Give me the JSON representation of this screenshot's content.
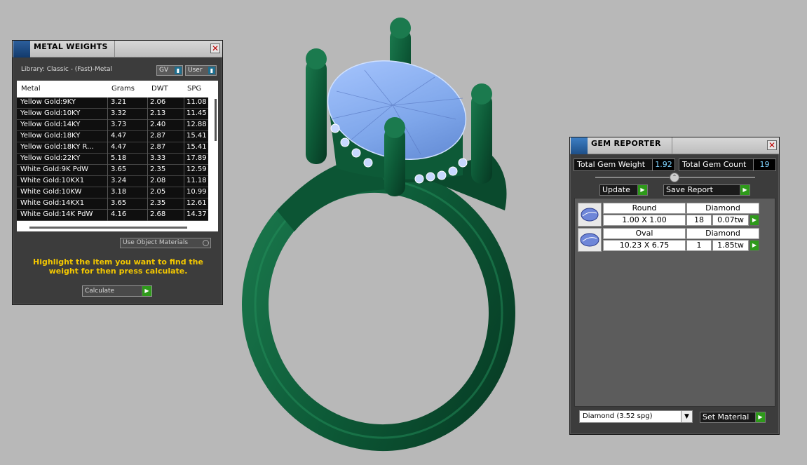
{
  "metal_weights": {
    "title": "METAL WEIGHTS",
    "library": "Library: Classic - (Fast)-Metal",
    "gv_label": "GV",
    "user_label": "User",
    "columns": [
      "Metal",
      "Grams",
      "DWT",
      "SPG"
    ],
    "rows": [
      [
        "Yellow Gold:9KY",
        "3.21",
        "2.06",
        "11.08"
      ],
      [
        "Yellow Gold:10KY",
        "3.32",
        "2.13",
        "11.45"
      ],
      [
        "Yellow Gold:14KY",
        "3.73",
        "2.40",
        "12.88"
      ],
      [
        "Yellow Gold:18KY",
        "4.47",
        "2.87",
        "15.41"
      ],
      [
        "Yellow Gold:18KY R...",
        "4.47",
        "2.87",
        "15.41"
      ],
      [
        "Yellow Gold:22KY",
        "5.18",
        "3.33",
        "17.89"
      ],
      [
        "White Gold:9K PdW",
        "3.65",
        "2.35",
        "12.59"
      ],
      [
        "White Gold:10KX1",
        "3.24",
        "2.08",
        "11.18"
      ],
      [
        "White Gold:10KW",
        "3.18",
        "2.05",
        "10.99"
      ],
      [
        "White Gold:14KX1",
        "3.65",
        "2.35",
        "12.61"
      ],
      [
        "White Gold:14K PdW",
        "4.16",
        "2.68",
        "14.37"
      ]
    ],
    "use_object_materials": "Use Object Materials",
    "hint": "Highlight the item you want to find the weight for then press calculate.",
    "calculate_label": "Calculate"
  },
  "gem_reporter": {
    "title": "GEM REPORTER",
    "total_weight_label": "Total Gem Weight",
    "total_weight_value": "1.92",
    "total_count_label": "Total Gem Count",
    "total_count_value": "19",
    "update_label": "Update",
    "save_report_label": "Save Report",
    "gems": [
      {
        "shape": "Round",
        "type": "Diamond",
        "size": "1.00 X 1.00",
        "count": "18",
        "weight": "0.07tw"
      },
      {
        "shape": "Oval",
        "type": "Diamond",
        "size": "10.23 X 6.75",
        "count": "1",
        "weight": "1.85tw"
      }
    ],
    "material_select": "Diamond      (3.52 spg)",
    "set_material_label": "Set Material"
  },
  "colors": {
    "background": "#b8b8b8",
    "ring_metal": "#0e5e3c",
    "gem": "#8fb4f0",
    "accent_go": "#2e9a1a",
    "hint_text": "#f4c800"
  }
}
